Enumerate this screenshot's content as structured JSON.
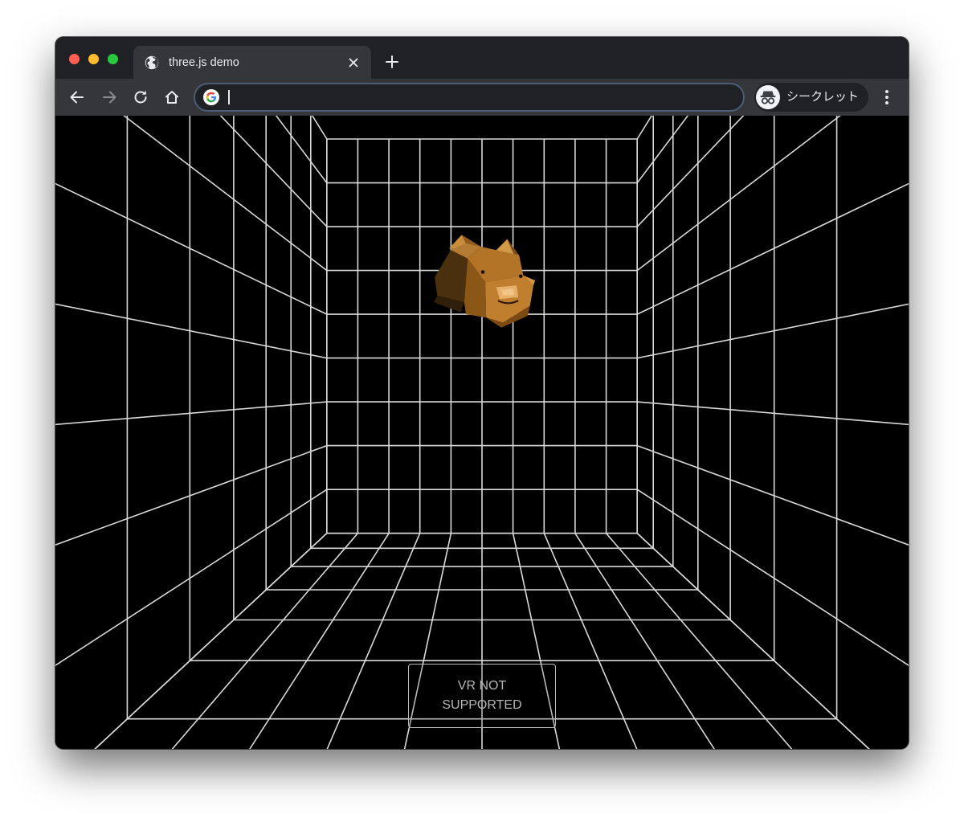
{
  "browser": {
    "tab": {
      "title": "three.js demo",
      "icon": "globe-icon"
    },
    "omnibox": {
      "value": "",
      "placeholder": "",
      "icon": "google-g-icon"
    },
    "incognito": {
      "label": "シークレット",
      "icon": "incognito-icon"
    },
    "colors": {
      "tabbar": "#202124",
      "toolbar": "#35363a",
      "omnibox_border": "#4b5d77"
    }
  },
  "page": {
    "scene": {
      "background": "#000000",
      "grid_color": "#d9d9d9",
      "model": "low-poly-boar-head"
    },
    "vr_button": {
      "label": "VR NOT\nSUPPORTED"
    }
  }
}
